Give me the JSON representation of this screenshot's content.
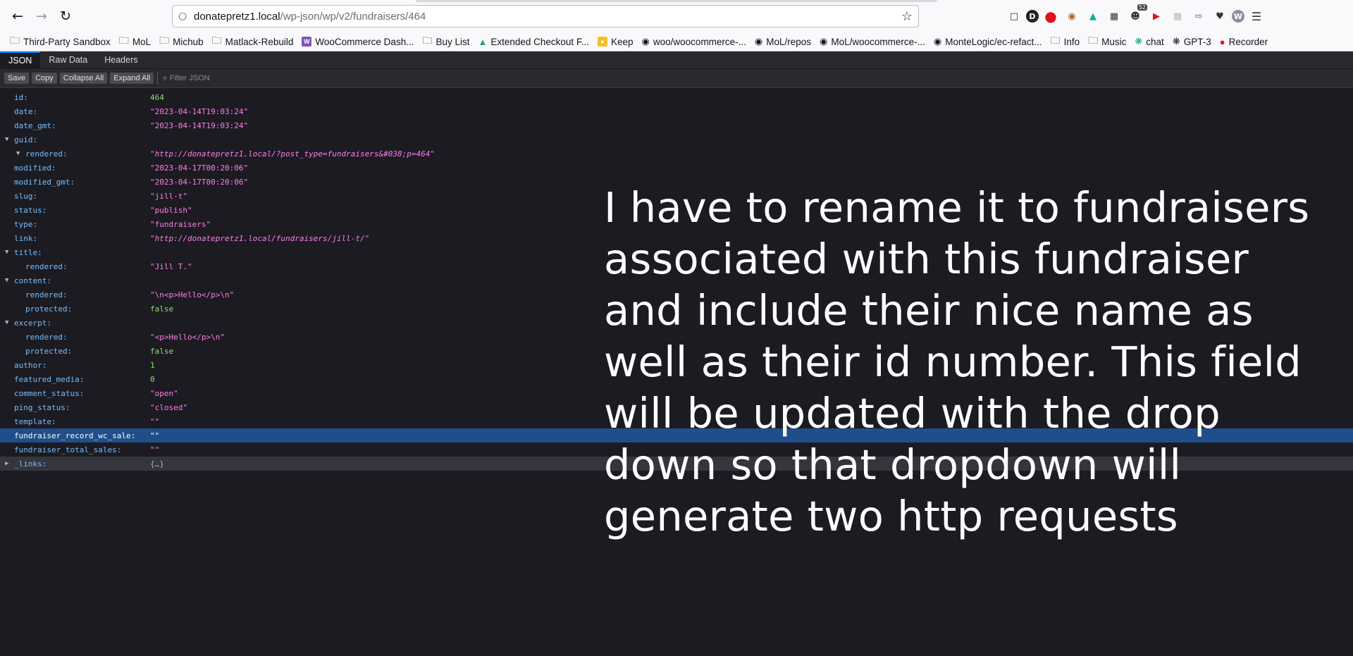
{
  "browser": {
    "url_host": "donatepretz1.local",
    "url_path": "/wp-json/wp/v2/fundraisers/464"
  },
  "bookmarks": [
    {
      "label": "Third-Party Sandbox",
      "icon": "folder-icon"
    },
    {
      "label": "MoL",
      "icon": "folder-icon"
    },
    {
      "label": "Michub",
      "icon": "folder-icon"
    },
    {
      "label": "Matlack-Rebuild",
      "icon": "folder-icon"
    },
    {
      "label": "WooCommerce Dash...",
      "icon": "woo-icon"
    },
    {
      "label": "Buy List",
      "icon": "folder-icon"
    },
    {
      "label": "Extended Checkout F...",
      "icon": "drive-icon"
    },
    {
      "label": "Keep",
      "icon": "keep-icon"
    },
    {
      "label": "woo/woocommerce-...",
      "icon": "github-icon"
    },
    {
      "label": "MoL/repos",
      "icon": "github-icon"
    },
    {
      "label": "MoL/woocommerce-...",
      "icon": "github-icon"
    },
    {
      "label": "MonteLogic/ec-refact...",
      "icon": "github-icon"
    },
    {
      "label": "Info",
      "icon": "folder-icon"
    },
    {
      "label": "Music",
      "icon": "folder-icon"
    },
    {
      "label": "chat",
      "icon": "openai-icon"
    },
    {
      "label": "GPT-3",
      "icon": "openai-icon"
    },
    {
      "label": "Recorder",
      "icon": "record-icon"
    }
  ],
  "extensions": {
    "badge_count": "52",
    "avatar_letter": "W",
    "dark_letter": "D"
  },
  "viewer": {
    "tabs": [
      "JSON",
      "Raw Data",
      "Headers"
    ],
    "buttons": [
      "Save",
      "Copy",
      "Collapse All",
      "Expand All"
    ],
    "filter_placeholder": "Filter JSON"
  },
  "json_rows": {
    "id": {
      "key": "id:",
      "value": "464"
    },
    "date": {
      "key": "date:",
      "value": "\"2023-04-14T19:03:24\""
    },
    "date_gmt": {
      "key": "date_gmt:",
      "value": "\"2023-04-14T19:03:24\""
    },
    "guid": {
      "key": "guid:"
    },
    "guid_rendered": {
      "key": "rendered:",
      "value": "\"http://donatepretz1.local/?post_type=fundraisers&#038;p=464\""
    },
    "modified": {
      "key": "modified:",
      "value": "\"2023-04-17T00:20:06\""
    },
    "modified_gmt": {
      "key": "modified_gmt:",
      "value": "\"2023-04-17T00:20:06\""
    },
    "slug": {
      "key": "slug:",
      "value": "\"jill-t\""
    },
    "status": {
      "key": "status:",
      "value": "\"publish\""
    },
    "type": {
      "key": "type:",
      "value": "\"fundraisers\""
    },
    "link": {
      "key": "link:",
      "value": "\"http://donatepretz1.local/fundraisers/jill-t/\""
    },
    "title": {
      "key": "title:"
    },
    "title_rendered": {
      "key": "rendered:",
      "value": "\"Jill T.\""
    },
    "content": {
      "key": "content:"
    },
    "content_rendered": {
      "key": "rendered:",
      "value": "\"\\n<p>Hello</p>\\n\""
    },
    "content_protected": {
      "key": "protected:",
      "value": "false"
    },
    "excerpt": {
      "key": "excerpt:"
    },
    "excerpt_rendered": {
      "key": "rendered:",
      "value": "\"<p>Hello</p>\\n\""
    },
    "excerpt_protected": {
      "key": "protected:",
      "value": "false"
    },
    "author": {
      "key": "author:",
      "value": "1"
    },
    "featured_media": {
      "key": "featured_media:",
      "value": "0"
    },
    "comment_status": {
      "key": "comment_status:",
      "value": "\"open\""
    },
    "ping_status": {
      "key": "ping_status:",
      "value": "\"closed\""
    },
    "template": {
      "key": "template:",
      "value": "\"\""
    },
    "fundraiser_record_wc_sale": {
      "key": "fundraiser_record_wc_sale:",
      "value": "\"\""
    },
    "fundraiser_total_sales": {
      "key": "fundraiser_total_sales:",
      "value": "\"\""
    },
    "links": {
      "key": "_links:",
      "value": "{…}"
    }
  },
  "overlay_text": "I have to rename it to fundraisers associated with this fundraiser and include their nice name as well as their id number. This field will be updated with the drop down so that dropdown will generate two http requests",
  "colors": {
    "key": "#75bfff",
    "string": "#ff7de9",
    "number": "#86de74",
    "selected_row": "#204e8a",
    "background": "#1c1b22"
  }
}
